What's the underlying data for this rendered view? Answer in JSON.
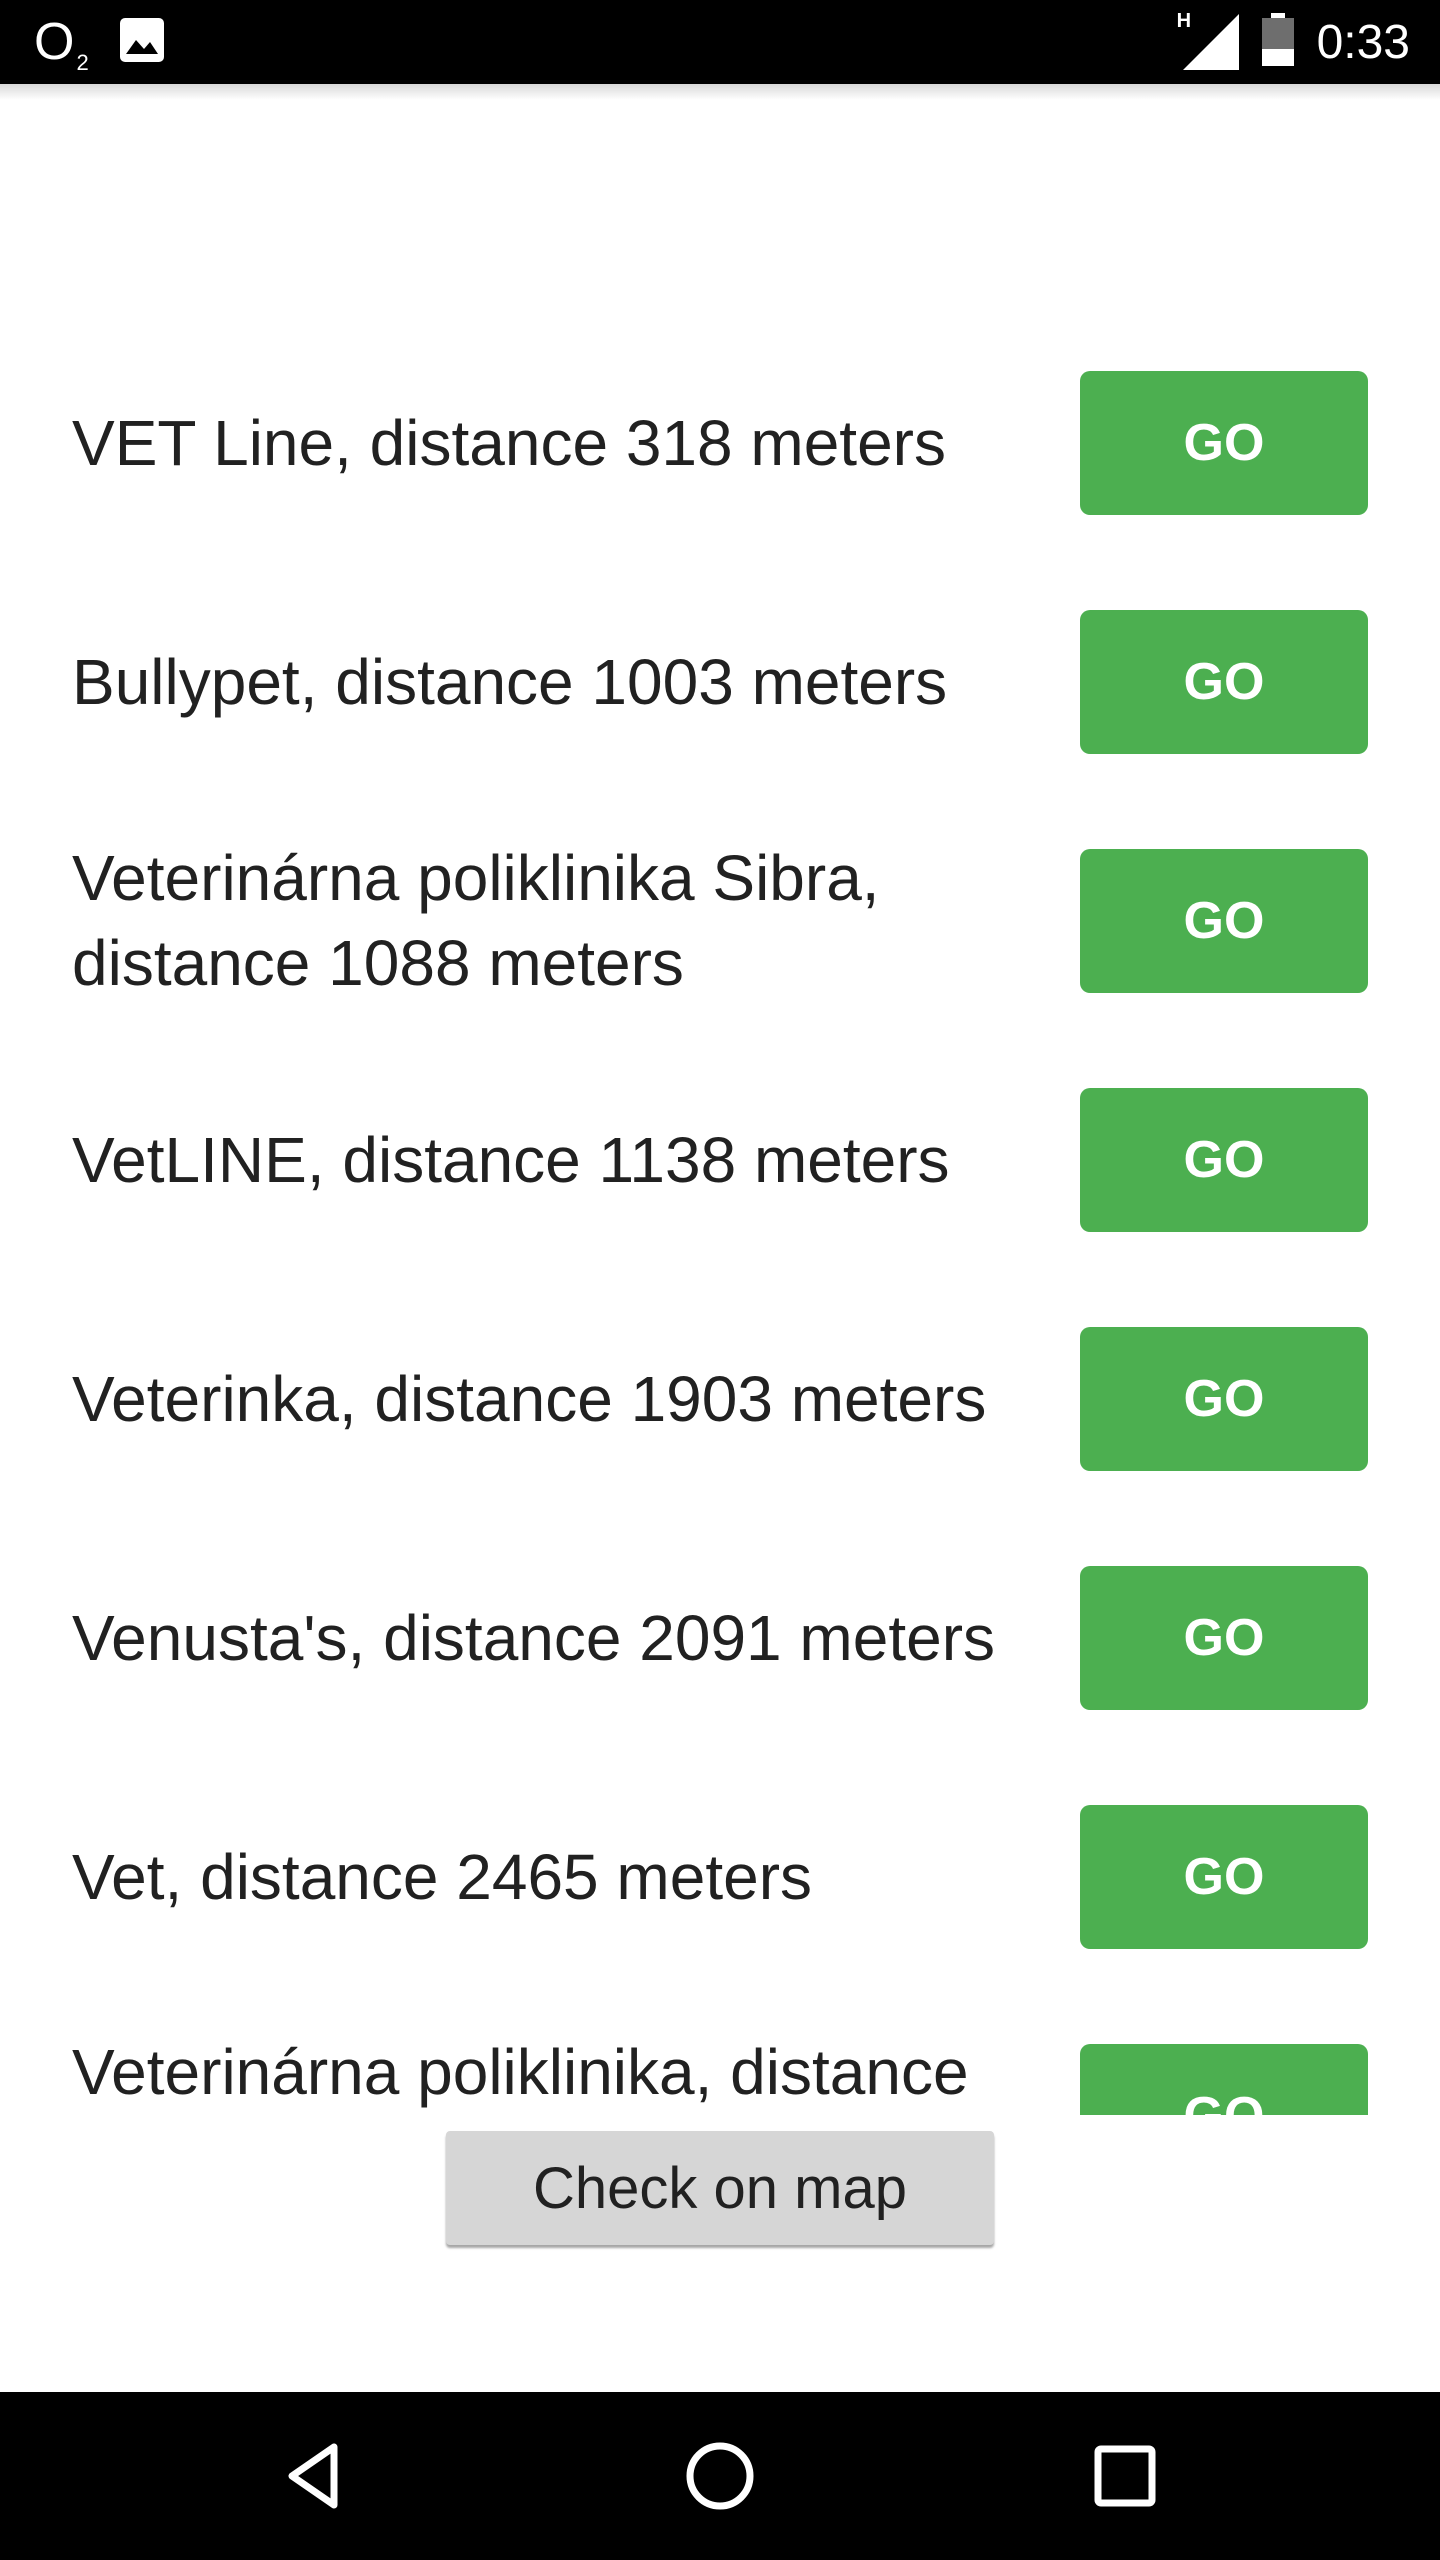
{
  "status_bar": {
    "carrier": "O",
    "carrier_sub": "2",
    "network_type": "H",
    "time": "0:33",
    "icons": [
      "image-notification-icon",
      "signal-icon",
      "battery-icon"
    ]
  },
  "colors": {
    "go_button": "#4caf50",
    "map_button": "#d6d6d6",
    "text": "#212121",
    "bars": "#000000"
  },
  "places": [
    {
      "label": "VET Line, distance 318 meters",
      "button": "GO"
    },
    {
      "label": "Bullypet, distance 1003 meters",
      "button": "GO"
    },
    {
      "label": "Veterinárna poliklinika Sibra, distance 1088 meters",
      "button": "GO"
    },
    {
      "label": "VetLINE, distance 1138 meters",
      "button": "GO"
    },
    {
      "label": "Veterinka, distance 1903 meters",
      "button": "GO"
    },
    {
      "label": "Venusta's, distance 2091 meters",
      "button": "GO"
    },
    {
      "label": "Vet, distance 2465 meters",
      "button": "GO"
    },
    {
      "label": "Veterinárna poliklinika, distance",
      "button": "GO"
    }
  ],
  "map_button": {
    "label": "Check on map"
  },
  "nav": {
    "icons": [
      "back-icon",
      "home-icon",
      "recents-icon"
    ]
  }
}
